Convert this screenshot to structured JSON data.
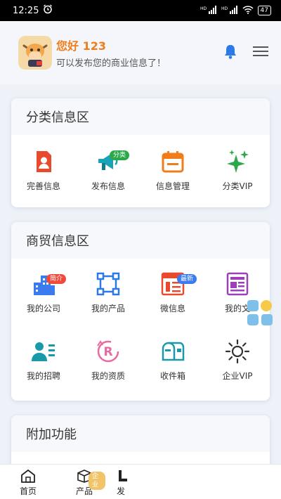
{
  "status_bar": {
    "time": "12:25",
    "network": "HD",
    "battery": "47"
  },
  "header": {
    "username": "您好 123",
    "tagline": "可以发布您的商业信息了！"
  },
  "sections": [
    {
      "title": "分类信息区",
      "items": [
        {
          "label": "完善信息",
          "icon": "profile-document-icon",
          "badge": ""
        },
        {
          "label": "发布信息",
          "icon": "megaphone-icon",
          "badge": "分类"
        },
        {
          "label": "信息管理",
          "icon": "calendar-manage-icon",
          "badge": ""
        },
        {
          "label": "分类VIP",
          "icon": "sparkle-icon",
          "badge": ""
        }
      ]
    },
    {
      "title": "商贸信息区",
      "items": [
        {
          "label": "我的公司",
          "icon": "buildings-icon",
          "badge": "简介"
        },
        {
          "label": "我的产品",
          "icon": "nodes-square-icon",
          "badge": ""
        },
        {
          "label": "微信息",
          "icon": "document-list-icon",
          "badge": "最新"
        },
        {
          "label": "我的文",
          "icon": "newspaper-icon",
          "badge": ""
        },
        {
          "label": "我的招聘",
          "icon": "people-recruit-icon",
          "badge": ""
        },
        {
          "label": "我的资质",
          "icon": "registered-badge-icon",
          "badge": ""
        },
        {
          "label": "收件箱",
          "icon": "mailbox-icon",
          "badge": ""
        },
        {
          "label": "企业VIP",
          "icon": "sun-icon",
          "badge": ""
        }
      ]
    },
    {
      "title": "附加功能",
      "items": []
    }
  ],
  "tabbar": {
    "tabs": [
      {
        "label": "首页",
        "icon": "home-icon"
      },
      {
        "label": "产品",
        "icon": "box-icon",
        "badge": "企业"
      },
      {
        "label": "发",
        "icon": "publish-icon"
      }
    ]
  },
  "colors": {
    "accent_orange": "#f07d1a",
    "accent_blue": "#2c7be5",
    "badge_red": "#f04a3b",
    "badge_green": "#2aa84a",
    "badge_blue": "#3a7bf0"
  }
}
